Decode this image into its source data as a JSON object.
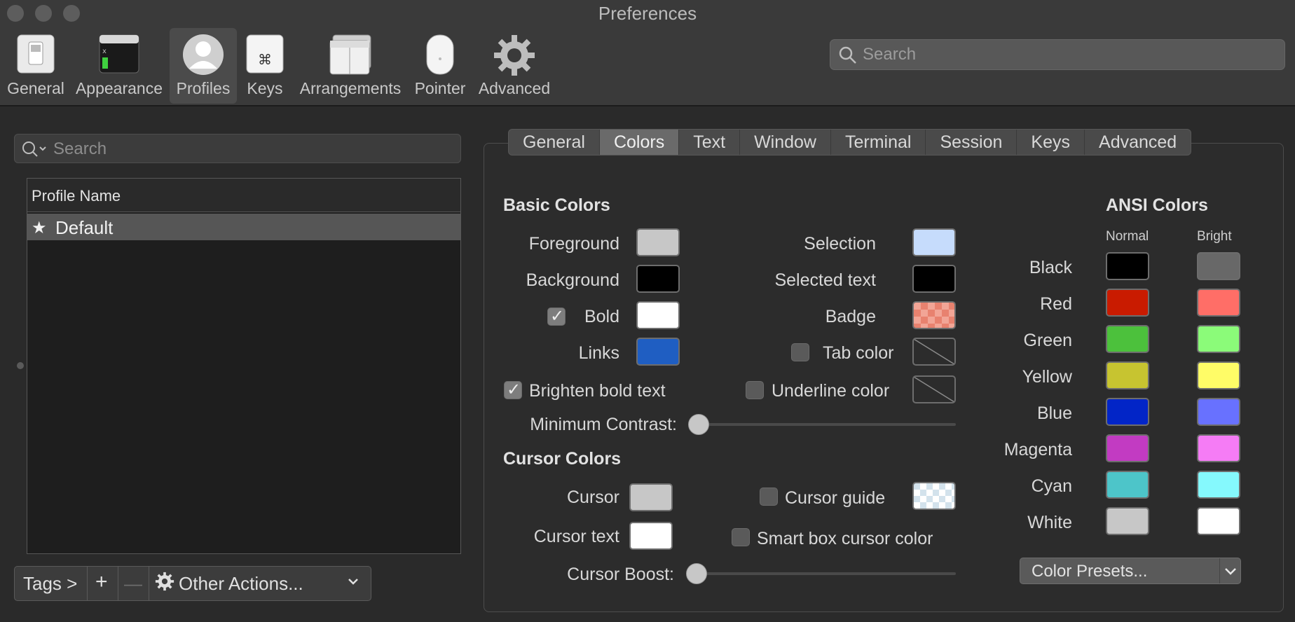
{
  "window": {
    "title": "Preferences"
  },
  "toolbar": {
    "items": [
      {
        "label": "General",
        "icon": "switch-icon"
      },
      {
        "label": "Appearance",
        "icon": "window-icon"
      },
      {
        "label": "Profiles",
        "icon": "user-icon",
        "active": true
      },
      {
        "label": "Keys",
        "icon": "command-key-icon"
      },
      {
        "label": "Arrangements",
        "icon": "windows-stack-icon"
      },
      {
        "label": "Pointer",
        "icon": "mouse-icon"
      },
      {
        "label": "Advanced",
        "icon": "gear-icon"
      }
    ],
    "search_placeholder": "Search"
  },
  "profiles": {
    "search_placeholder": "Search",
    "column_header": "Profile Name",
    "rows": [
      {
        "name": "Default",
        "is_default": true
      }
    ],
    "bottom_bar": {
      "tags": "Tags >",
      "add": "+",
      "remove": "—",
      "other_actions": "Other Actions..."
    }
  },
  "tabs": [
    "General",
    "Colors",
    "Text",
    "Window",
    "Terminal",
    "Session",
    "Keys",
    "Advanced"
  ],
  "active_tab": "Colors",
  "basic_colors": {
    "title": "Basic Colors",
    "foreground": {
      "label": "Foreground",
      "color": "#c7c7c7"
    },
    "background": {
      "label": "Background",
      "color": "#000000"
    },
    "bold": {
      "label": "Bold",
      "color": "#ffffff",
      "checked": true
    },
    "links": {
      "label": "Links",
      "color": "#1f5ec2"
    },
    "selection": {
      "label": "Selection",
      "color": "#c6dcfc"
    },
    "selected_text": {
      "label": "Selected text",
      "color": "#000000"
    },
    "badge": {
      "label": "Badge",
      "color": "#e8826f"
    },
    "tab_color": {
      "label": "Tab color",
      "checked": false
    },
    "underline_color": {
      "label": "Underline color",
      "checked": false
    },
    "brighten_bold": {
      "label": "Brighten bold text",
      "checked": true
    },
    "minimum_contrast": {
      "label": "Minimum Contrast:",
      "value": 0
    }
  },
  "cursor_colors": {
    "title": "Cursor Colors",
    "cursor": {
      "label": "Cursor",
      "color": "#c7c7c7"
    },
    "cursor_text": {
      "label": "Cursor text",
      "color": "#ffffff"
    },
    "cursor_guide": {
      "label": "Cursor guide",
      "checked": false
    },
    "smart_box": {
      "label": "Smart box cursor color",
      "checked": false
    },
    "cursor_boost": {
      "label": "Cursor Boost:",
      "value": 0
    }
  },
  "ansi_colors": {
    "title": "ANSI Colors",
    "normal_label": "Normal",
    "bright_label": "Bright",
    "rows": [
      {
        "name": "Black",
        "normal": "#000000",
        "bright": "#686868"
      },
      {
        "name": "Red",
        "normal": "#c91b00",
        "bright": "#ff6e67"
      },
      {
        "name": "Green",
        "normal": "#4cc13c",
        "bright": "#8bfb79"
      },
      {
        "name": "Yellow",
        "normal": "#c7c430",
        "bright": "#fffc67"
      },
      {
        "name": "Blue",
        "normal": "#0225c7",
        "bright": "#6871ff"
      },
      {
        "name": "Magenta",
        "normal": "#c23bc2",
        "bright": "#f57cf5"
      },
      {
        "name": "Cyan",
        "normal": "#4dc5c9",
        "bright": "#85f9fd"
      },
      {
        "name": "White",
        "normal": "#c7c7c7",
        "bright": "#ffffff"
      }
    ],
    "presets_label": "Color Presets..."
  }
}
